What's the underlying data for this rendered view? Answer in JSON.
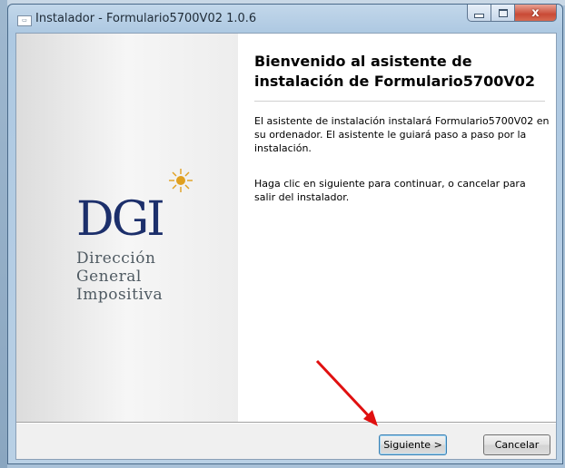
{
  "window": {
    "title": "Instalador - Formulario5700V02 1.0.6",
    "icon": "installer-app-icon"
  },
  "title_controls": {
    "minimize_icon": "minimize-icon",
    "maximize_icon": "maximize-icon",
    "close_icon": "close-icon",
    "close_glyph": "x"
  },
  "logo": {
    "acronym": "DGI",
    "line1": "Dirección",
    "line2": "General",
    "line3": "Impositiva",
    "sun_color": "#e0a020",
    "acronym_color": "#1c2f6b"
  },
  "content": {
    "heading": "Bienvenido al asistente de instalación de Formulario5700V02",
    "paragraph1": "El asistente de instalación instalará Formulario5700V02 en su ordenador. El asistente le guiará paso a paso por la instalación.",
    "paragraph2": "Haga clic en siguiente para continuar, o cancelar para salir del instalador."
  },
  "buttons": {
    "next": "Siguiente >",
    "cancel": "Cancelar"
  },
  "annotation": {
    "arrow_color": "#e01010",
    "arrow_icon": "red-arrow-annotation"
  }
}
